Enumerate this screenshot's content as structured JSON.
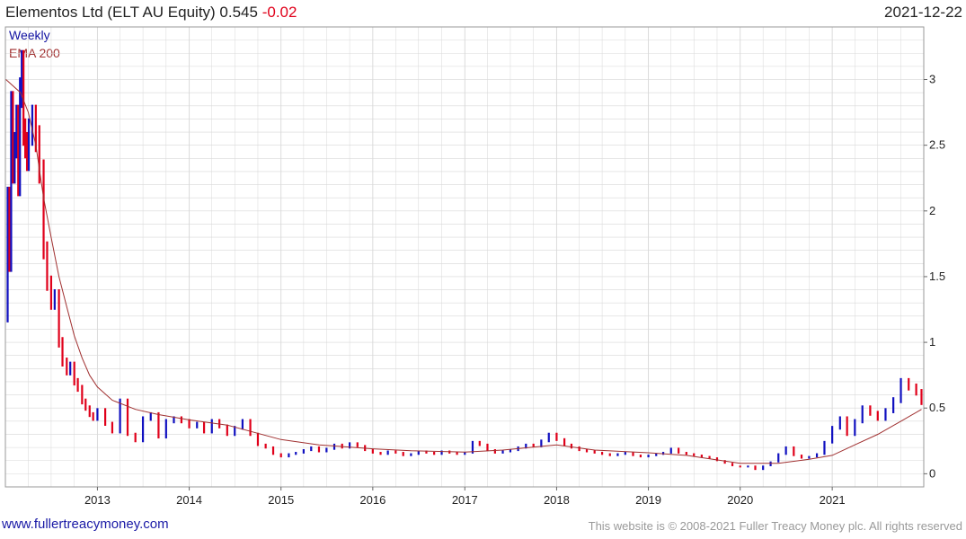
{
  "header": {
    "title": "Elementos Ltd (ELT AU Equity) 0.545",
    "change": "-0.02",
    "date": "2021-12-22"
  },
  "legend": {
    "weekly": "Weekly",
    "ema": "EMA 200"
  },
  "footer": {
    "site": "www.fullertreacymoney.com",
    "copyright": "This website is © 2008-2021 Fuller Treacy Money plc. All rights reserved"
  },
  "colors": {
    "up": "#1010c0",
    "down": "#e0001a",
    "ema": "#a03030",
    "grid": "#d8d8d8"
  },
  "chart_data": {
    "type": "line",
    "series_type": "ohlc-weekly",
    "x_domain": [
      "2012-01-01",
      "2021-12-31"
    ],
    "ylim": [
      -0.1,
      3.4
    ],
    "y_ticks": [
      0,
      0.5,
      1,
      1.5,
      2,
      2.5,
      3
    ],
    "y_tick_labels": [
      "0",
      "0.5",
      "1",
      "1.5",
      "2",
      "2.5",
      "3"
    ],
    "x_ticks": [
      "2013-01-01",
      "2014-01-01",
      "2015-01-01",
      "2016-01-01",
      "2017-01-01",
      "2018-01-01",
      "2019-01-01",
      "2020-01-01",
      "2021-01-01"
    ],
    "x_tick_labels": [
      "2013",
      "2014",
      "2015",
      "2016",
      "2017",
      "2018",
      "2019",
      "2020",
      "2021"
    ],
    "grid": true,
    "price": {
      "name": "Weekly",
      "points": [
        [
          "2012-01-03",
          1.2
        ],
        [
          "2012-01-10",
          2.1
        ],
        [
          "2012-01-17",
          1.6
        ],
        [
          "2012-01-24",
          2.8
        ],
        [
          "2012-01-31",
          2.3
        ],
        [
          "2012-02-07",
          2.5
        ],
        [
          "2012-02-14",
          2.7
        ],
        [
          "2012-02-21",
          2.2
        ],
        [
          "2012-02-28",
          2.9
        ],
        [
          "2012-03-06",
          3.1
        ],
        [
          "2012-03-13",
          2.6
        ],
        [
          "2012-03-20",
          2.5
        ],
        [
          "2012-03-27",
          2.4
        ],
        [
          "2012-04-03",
          2.6
        ],
        [
          "2012-04-17",
          2.7
        ],
        [
          "2012-05-01",
          2.55
        ],
        [
          "2012-05-15",
          2.3
        ],
        [
          "2012-06-01",
          1.7
        ],
        [
          "2012-06-15",
          1.45
        ],
        [
          "2012-07-01",
          1.3
        ],
        [
          "2012-07-15",
          1.35
        ],
        [
          "2012-08-01",
          1.0
        ],
        [
          "2012-08-15",
          0.85
        ],
        [
          "2012-09-01",
          0.78
        ],
        [
          "2012-09-15",
          0.82
        ],
        [
          "2012-10-01",
          0.7
        ],
        [
          "2012-10-15",
          0.65
        ],
        [
          "2012-11-01",
          0.55
        ],
        [
          "2012-11-15",
          0.5
        ],
        [
          "2012-12-01",
          0.45
        ],
        [
          "2012-12-15",
          0.42
        ],
        [
          "2013-01-01",
          0.48
        ],
        [
          "2013-02-01",
          0.38
        ],
        [
          "2013-03-01",
          0.32
        ],
        [
          "2013-04-01",
          0.55
        ],
        [
          "2013-05-01",
          0.3
        ],
        [
          "2013-06-01",
          0.25
        ],
        [
          "2013-07-01",
          0.42
        ],
        [
          "2013-08-01",
          0.45
        ],
        [
          "2013-09-01",
          0.28
        ],
        [
          "2013-10-01",
          0.4
        ],
        [
          "2013-11-01",
          0.42
        ],
        [
          "2013-12-01",
          0.4
        ],
        [
          "2014-01-01",
          0.36
        ],
        [
          "2014-02-01",
          0.38
        ],
        [
          "2014-03-01",
          0.32
        ],
        [
          "2014-04-01",
          0.4
        ],
        [
          "2014-05-01",
          0.36
        ],
        [
          "2014-06-01",
          0.3
        ],
        [
          "2014-07-01",
          0.35
        ],
        [
          "2014-08-01",
          0.4
        ],
        [
          "2014-09-01",
          0.3
        ],
        [
          "2014-10-01",
          0.22
        ],
        [
          "2014-11-01",
          0.2
        ],
        [
          "2014-12-01",
          0.15
        ],
        [
          "2015-01-01",
          0.13
        ],
        [
          "2015-02-01",
          0.15
        ],
        [
          "2015-03-01",
          0.16
        ],
        [
          "2015-04-01",
          0.18
        ],
        [
          "2015-05-01",
          0.2
        ],
        [
          "2015-06-01",
          0.17
        ],
        [
          "2015-07-01",
          0.19
        ],
        [
          "2015-08-01",
          0.22
        ],
        [
          "2015-09-01",
          0.2
        ],
        [
          "2015-10-01",
          0.23
        ],
        [
          "2015-11-01",
          0.21
        ],
        [
          "2015-12-01",
          0.18
        ],
        [
          "2016-01-01",
          0.16
        ],
        [
          "2016-02-01",
          0.15
        ],
        [
          "2016-03-01",
          0.17
        ],
        [
          "2016-04-01",
          0.16
        ],
        [
          "2016-05-01",
          0.14
        ],
        [
          "2016-06-01",
          0.15
        ],
        [
          "2016-07-01",
          0.17
        ],
        [
          "2016-08-01",
          0.16
        ],
        [
          "2016-09-01",
          0.15
        ],
        [
          "2016-10-01",
          0.17
        ],
        [
          "2016-11-01",
          0.16
        ],
        [
          "2016-12-01",
          0.15
        ],
        [
          "2017-01-01",
          0.16
        ],
        [
          "2017-02-01",
          0.24
        ],
        [
          "2017-03-01",
          0.22
        ],
        [
          "2017-04-01",
          0.18
        ],
        [
          "2017-05-01",
          0.16
        ],
        [
          "2017-06-01",
          0.17
        ],
        [
          "2017-07-01",
          0.18
        ],
        [
          "2017-08-01",
          0.2
        ],
        [
          "2017-09-01",
          0.22
        ],
        [
          "2017-10-01",
          0.21
        ],
        [
          "2017-11-01",
          0.25
        ],
        [
          "2017-12-01",
          0.3
        ],
        [
          "2018-01-01",
          0.26
        ],
        [
          "2018-02-01",
          0.22
        ],
        [
          "2018-03-01",
          0.2
        ],
        [
          "2018-04-01",
          0.18
        ],
        [
          "2018-05-01",
          0.17
        ],
        [
          "2018-06-01",
          0.16
        ],
        [
          "2018-07-01",
          0.15
        ],
        [
          "2018-08-01",
          0.14
        ],
        [
          "2018-09-01",
          0.15
        ],
        [
          "2018-10-01",
          0.16
        ],
        [
          "2018-11-01",
          0.14
        ],
        [
          "2018-12-01",
          0.13
        ],
        [
          "2019-01-01",
          0.14
        ],
        [
          "2019-02-01",
          0.15
        ],
        [
          "2019-03-01",
          0.16
        ],
        [
          "2019-04-01",
          0.19
        ],
        [
          "2019-05-01",
          0.16
        ],
        [
          "2019-06-01",
          0.15
        ],
        [
          "2019-07-01",
          0.14
        ],
        [
          "2019-08-01",
          0.13
        ],
        [
          "2019-09-01",
          0.12
        ],
        [
          "2019-10-01",
          0.1
        ],
        [
          "2019-11-01",
          0.08
        ],
        [
          "2019-12-01",
          0.06
        ],
        [
          "2020-01-01",
          0.05
        ],
        [
          "2020-02-01",
          0.06
        ],
        [
          "2020-03-01",
          0.03
        ],
        [
          "2020-04-01",
          0.06
        ],
        [
          "2020-05-01",
          0.09
        ],
        [
          "2020-06-01",
          0.15
        ],
        [
          "2020-07-01",
          0.2
        ],
        [
          "2020-08-01",
          0.14
        ],
        [
          "2020-09-01",
          0.12
        ],
        [
          "2020-10-01",
          0.13
        ],
        [
          "2020-11-01",
          0.15
        ],
        [
          "2020-12-01",
          0.24
        ],
        [
          "2021-01-01",
          0.35
        ],
        [
          "2021-02-01",
          0.42
        ],
        [
          "2021-03-01",
          0.3
        ],
        [
          "2021-04-01",
          0.4
        ],
        [
          "2021-05-01",
          0.5
        ],
        [
          "2021-06-01",
          0.46
        ],
        [
          "2021-07-01",
          0.42
        ],
        [
          "2021-08-01",
          0.48
        ],
        [
          "2021-09-01",
          0.56
        ],
        [
          "2021-10-01",
          0.7
        ],
        [
          "2021-11-01",
          0.66
        ],
        [
          "2021-12-01",
          0.62
        ],
        [
          "2021-12-22",
          0.545
        ]
      ]
    },
    "ema": {
      "name": "EMA 200",
      "points": [
        [
          "2012-01-03",
          3.0
        ],
        [
          "2012-03-01",
          2.9
        ],
        [
          "2012-04-01",
          2.75
        ],
        [
          "2012-05-01",
          2.5
        ],
        [
          "2012-06-01",
          2.1
        ],
        [
          "2012-07-01",
          1.8
        ],
        [
          "2012-08-01",
          1.5
        ],
        [
          "2012-09-01",
          1.27
        ],
        [
          "2012-10-01",
          1.05
        ],
        [
          "2012-11-01",
          0.88
        ],
        [
          "2012-12-01",
          0.75
        ],
        [
          "2013-01-01",
          0.66
        ],
        [
          "2013-03-01",
          0.56
        ],
        [
          "2013-06-01",
          0.49
        ],
        [
          "2013-09-01",
          0.45
        ],
        [
          "2014-01-01",
          0.41
        ],
        [
          "2014-06-01",
          0.37
        ],
        [
          "2015-01-01",
          0.26
        ],
        [
          "2015-06-01",
          0.22
        ],
        [
          "2016-01-01",
          0.19
        ],
        [
          "2016-06-01",
          0.175
        ],
        [
          "2017-01-01",
          0.165
        ],
        [
          "2017-06-01",
          0.18
        ],
        [
          "2018-01-01",
          0.22
        ],
        [
          "2018-06-01",
          0.18
        ],
        [
          "2019-01-01",
          0.16
        ],
        [
          "2019-06-01",
          0.14
        ],
        [
          "2020-01-01",
          0.08
        ],
        [
          "2020-06-01",
          0.08
        ],
        [
          "2020-10-01",
          0.11
        ],
        [
          "2021-01-01",
          0.14
        ],
        [
          "2021-04-01",
          0.22
        ],
        [
          "2021-07-01",
          0.3
        ],
        [
          "2021-10-01",
          0.4
        ],
        [
          "2021-12-22",
          0.49
        ]
      ]
    }
  }
}
